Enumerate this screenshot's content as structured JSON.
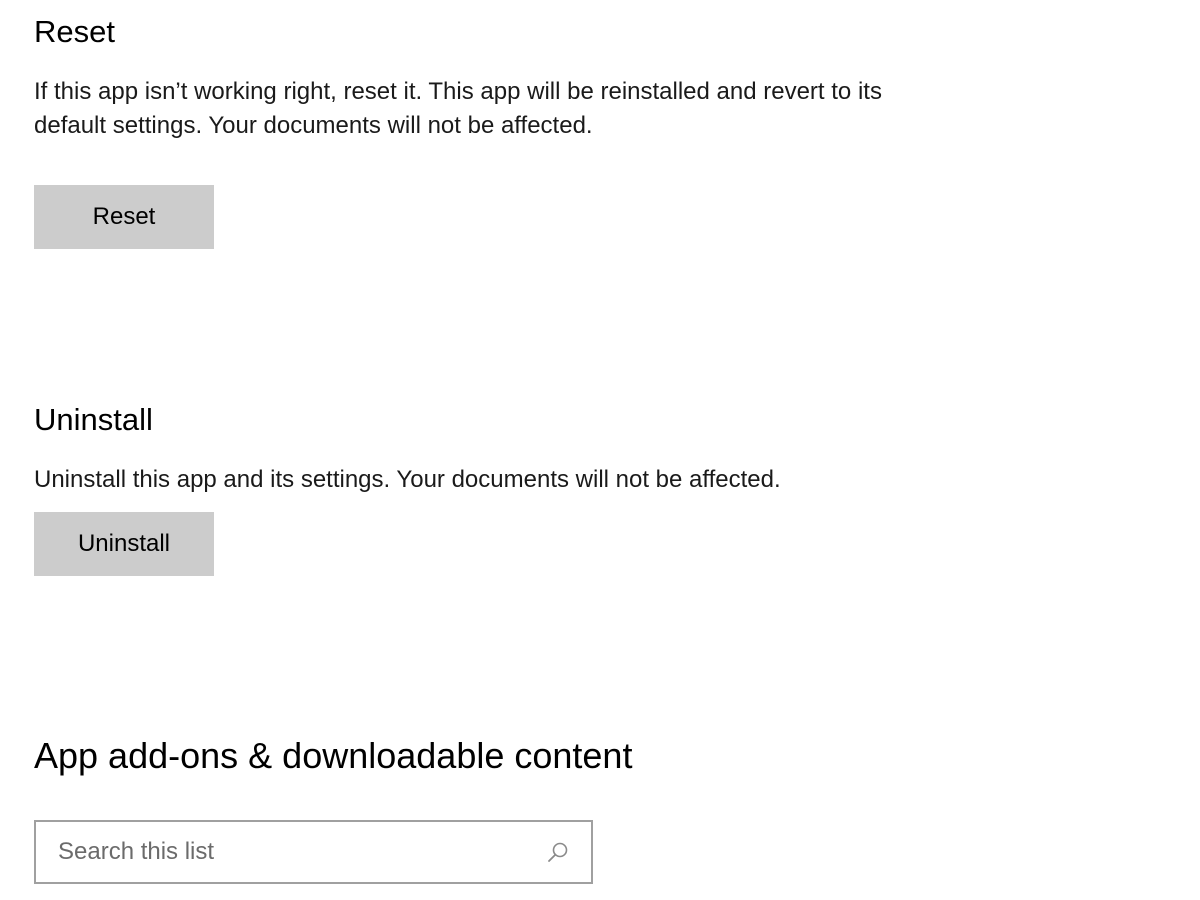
{
  "reset": {
    "title": "Reset",
    "description": "If this app isn’t working right, reset it. This app will be reinstalled and revert to its default settings. Your documents will not be affected.",
    "button_label": "Reset"
  },
  "uninstall": {
    "title": "Uninstall",
    "description": "Uninstall this app and its settings. Your documents will not be affected.",
    "button_label": "Uninstall"
  },
  "addons": {
    "title": "App add-ons & downloadable content",
    "search": {
      "placeholder": "Search this list",
      "value": "",
      "icon": "search-icon"
    }
  },
  "colors": {
    "button_bg": "#cccccc",
    "search_border": "#a0a0a0",
    "placeholder": "#6b6b6b"
  }
}
